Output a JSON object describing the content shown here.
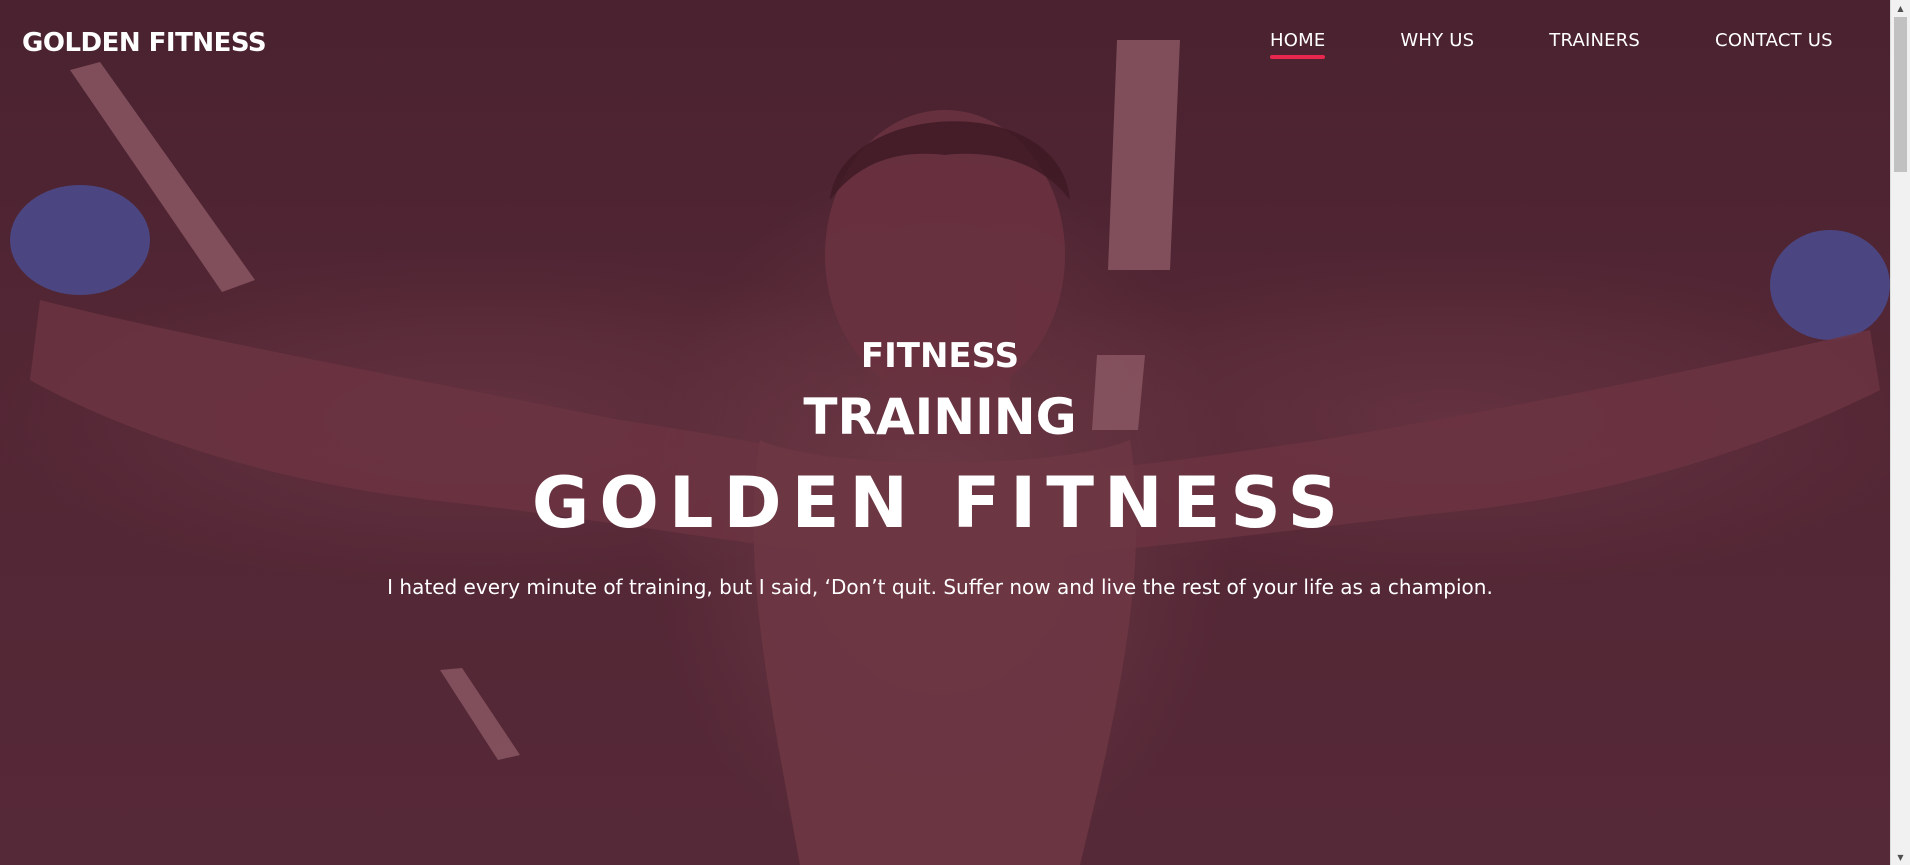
{
  "header": {
    "brand": "GOLDEN FITNESS"
  },
  "nav": {
    "items": [
      {
        "label": "HOME",
        "active": true
      },
      {
        "label": "WHY US",
        "active": false
      },
      {
        "label": "TRAINERS",
        "active": false
      },
      {
        "label": "CONTACT US",
        "active": false
      }
    ]
  },
  "hero": {
    "kicker": "FITNESS",
    "subhead": "TRAINING",
    "headline": "GOLDEN FITNESS",
    "quote": "I hated every minute of training, but I said, ‘Don’t quit. Suffer now and live the rest of your life as a champion."
  },
  "colors": {
    "overlay": "#4e2533",
    "accent": "#e8274f",
    "text": "#ffffff"
  },
  "icons": {
    "scroll_up": "triangle-up",
    "scroll_down": "triangle-down"
  }
}
